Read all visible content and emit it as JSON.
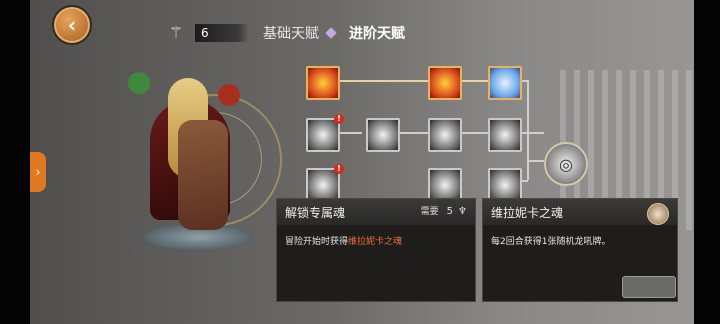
{
  "header": {
    "talent_points": "6",
    "tabs": [
      {
        "label": "基础天赋"
      },
      {
        "label": "进阶天赋"
      }
    ],
    "icons": {
      "back": "back-arrow-icon",
      "rune": "rune-icon",
      "side": "chevron-right-icon"
    }
  },
  "talent_tree": {
    "nodes": [
      {
        "id": "fire-1",
        "style": "fire"
      },
      {
        "id": "fire-2",
        "style": "fire"
      },
      {
        "id": "ice-1",
        "style": "ice"
      },
      {
        "id": "gray-1",
        "style": "gray",
        "alert": true
      },
      {
        "id": "gray-2",
        "style": "gray"
      },
      {
        "id": "gray-3",
        "style": "gray"
      },
      {
        "id": "gray-4",
        "style": "gray"
      },
      {
        "id": "gray-5",
        "style": "gray",
        "alert": true
      },
      {
        "id": "gray-6",
        "style": "gray"
      },
      {
        "id": "gray-7",
        "style": "gray"
      },
      {
        "id": "final",
        "style": "round"
      }
    ],
    "badge_text": "!"
  },
  "unlock_panel": {
    "title": "解锁专属魂",
    "need_label": "需要",
    "need_value": "5",
    "desc_prefix": "冒险开始时获得",
    "desc_highlight": "维拉妮卡之魂"
  },
  "soul_panel": {
    "title": "维拉妮卡之魂",
    "desc": "每2回合获得1张随机龙吼牌。"
  },
  "colors": {
    "highlight": "#e8703a",
    "accent_line": "#e8d49a",
    "back_button": "#c9772e"
  }
}
